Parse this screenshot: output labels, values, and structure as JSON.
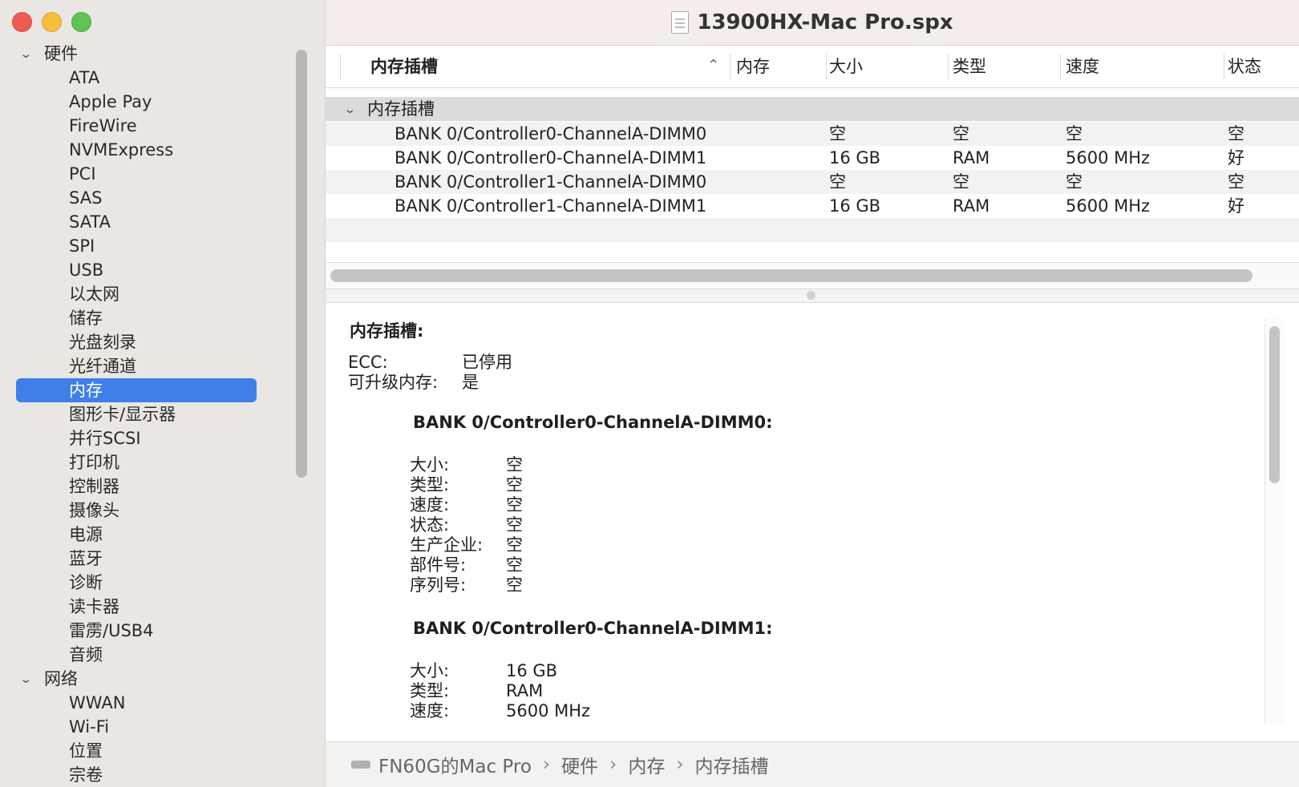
{
  "window": {
    "title": "13900HX-Mac Pro.spx"
  },
  "sidebar": {
    "groups": [
      {
        "label": "硬件",
        "items": [
          "ATA",
          "Apple Pay",
          "FireWire",
          "NVMExpress",
          "PCI",
          "SAS",
          "SATA",
          "SPI",
          "USB",
          "以太网",
          "储存",
          "光盘刻录",
          "光纤通道",
          "内存",
          "图形卡/显示器",
          "并行SCSI",
          "打印机",
          "控制器",
          "摄像头",
          "电源",
          "蓝牙",
          "诊断",
          "读卡器",
          "雷雳/USB4",
          "音频"
        ]
      },
      {
        "label": "网络",
        "items": [
          "WWAN",
          "Wi-Fi",
          "位置",
          "宗卷"
        ]
      }
    ],
    "selected": "内存"
  },
  "table": {
    "headers": {
      "slot": "内存插槽",
      "memory": "内存",
      "size": "大小",
      "type": "类型",
      "speed": "速度",
      "status": "状态"
    },
    "group_label": "内存插槽",
    "rows": [
      {
        "name": "BANK 0/Controller0-ChannelA-DIMM0",
        "size": "空",
        "type": "空",
        "speed": "空",
        "status": "空"
      },
      {
        "name": "BANK 0/Controller0-ChannelA-DIMM1",
        "size": "16 GB",
        "type": "RAM",
        "speed": "5600 MHz",
        "status": "好"
      },
      {
        "name": "BANK 0/Controller1-ChannelA-DIMM0",
        "size": "空",
        "type": "空",
        "speed": "空",
        "status": "空"
      },
      {
        "name": "BANK 0/Controller1-ChannelA-DIMM1",
        "size": "16 GB",
        "type": "RAM",
        "speed": "5600 MHz",
        "status": "好"
      }
    ]
  },
  "detail": {
    "title": "内存插槽:",
    "summary": [
      {
        "k": "ECC:",
        "v": "已停用"
      },
      {
        "k": "可升级内存:",
        "v": "是"
      }
    ],
    "slots": [
      {
        "title": "BANK 0/Controller0-ChannelA-DIMM0:",
        "fields": [
          {
            "k": "大小:",
            "v": "空"
          },
          {
            "k": "类型:",
            "v": "空"
          },
          {
            "k": "速度:",
            "v": "空"
          },
          {
            "k": "状态:",
            "v": "空"
          },
          {
            "k": "生产企业:",
            "v": "空"
          },
          {
            "k": "部件号:",
            "v": "空"
          },
          {
            "k": "序列号:",
            "v": "空"
          }
        ]
      },
      {
        "title": "BANK 0/Controller0-ChannelA-DIMM1:",
        "fields": [
          {
            "k": "大小:",
            "v": "16 GB"
          },
          {
            "k": "类型:",
            "v": "RAM"
          },
          {
            "k": "速度:",
            "v": "5600 MHz"
          }
        ]
      }
    ]
  },
  "statusbar": {
    "crumbs": [
      "FN60G的Mac Pro",
      "硬件",
      "内存",
      "内存插槽"
    ],
    "separator": "›"
  },
  "icons": {
    "window_close": "close-button",
    "window_minimize": "minimize-button",
    "window_zoom": "zoom-button",
    "disclosure": "chevron-down-icon",
    "sort": "chevron-up-icon",
    "document": "document-icon",
    "drive": "drive-icon"
  }
}
